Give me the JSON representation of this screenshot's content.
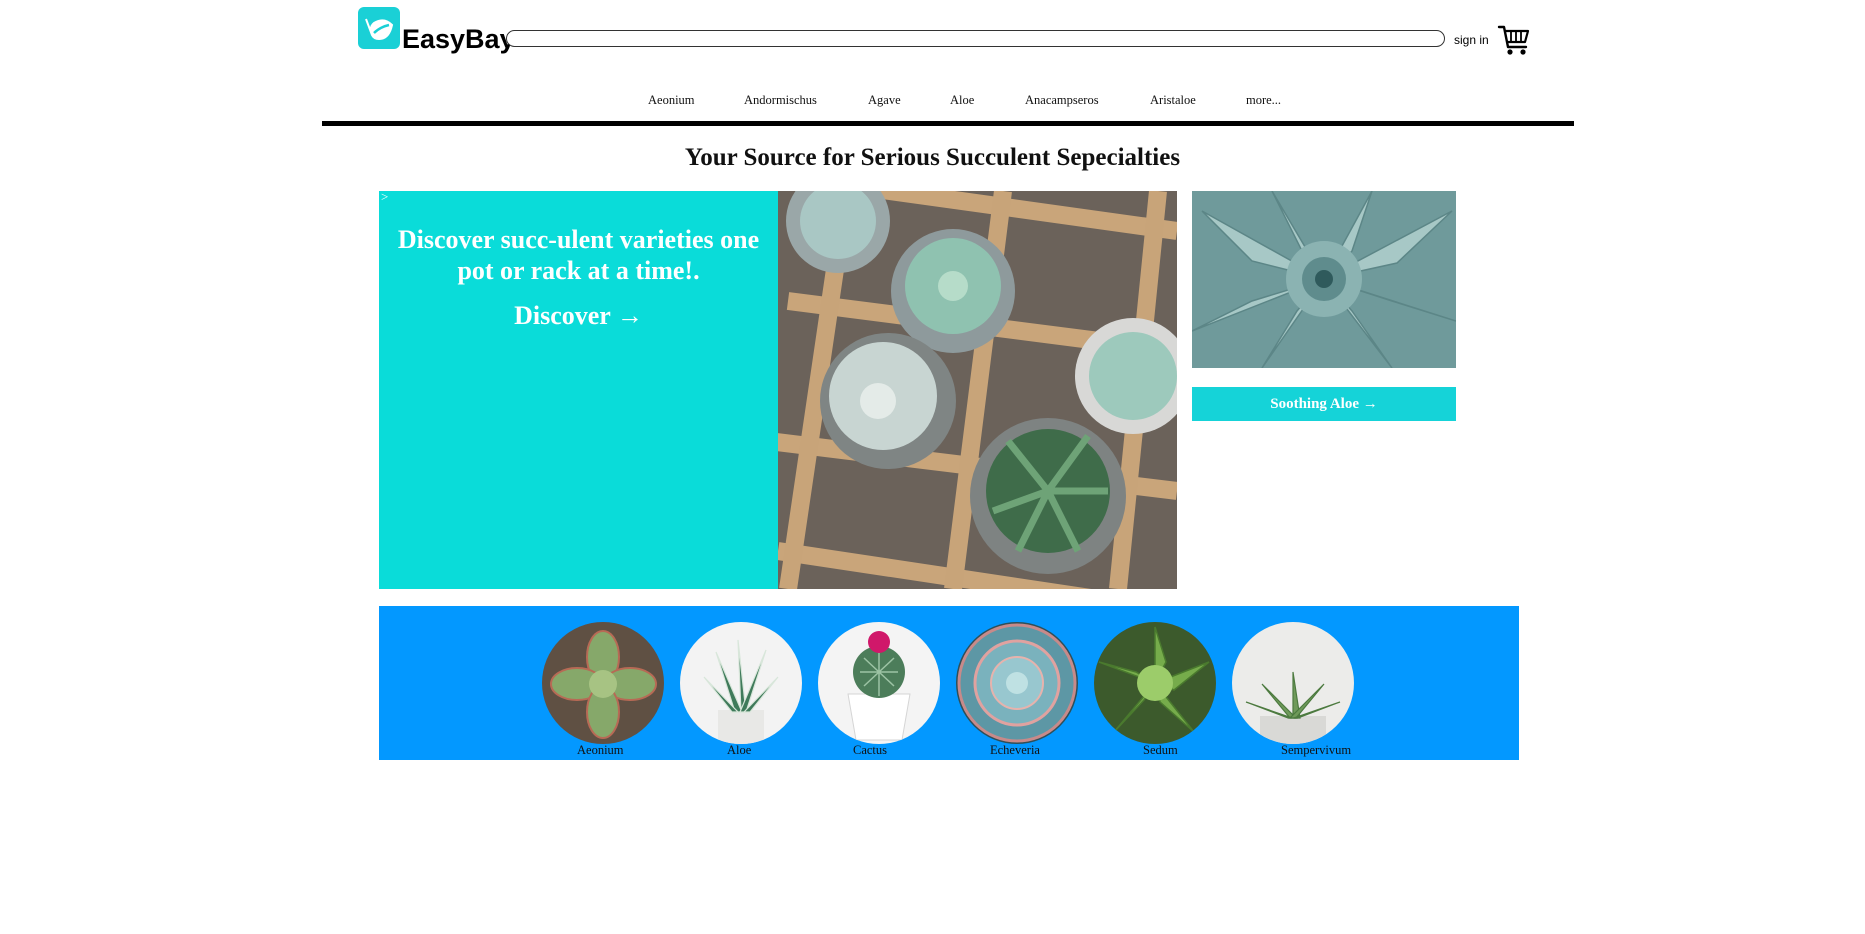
{
  "brand": {
    "name": "EasyBay",
    "accent": "#1ad0d6"
  },
  "header": {
    "search_value": "",
    "signin_label": "sign in",
    "cart_icon": "shopping-cart-icon"
  },
  "nav": {
    "items": [
      "Aeonium",
      "Andormischus",
      "Agave",
      "Aloe",
      "Anacampseros",
      "Aristaloe",
      "more..."
    ]
  },
  "headline": "Your Source for Serious Succulent Sepecialties",
  "hero": {
    "caret": ">",
    "text": "Discover succ-ulent varieties one pot or rack at a time!.",
    "cta": "Discover →",
    "panel_color": "#0adcd9"
  },
  "side": {
    "button_label": "Soothing Aloe →",
    "button_color": "#15d3d8"
  },
  "categories": {
    "band_color": "#0398ff",
    "items": [
      "Aeonium",
      "Aloe",
      "Cactus",
      "Echeveria",
      "Sedum",
      "Sempervivum"
    ]
  }
}
